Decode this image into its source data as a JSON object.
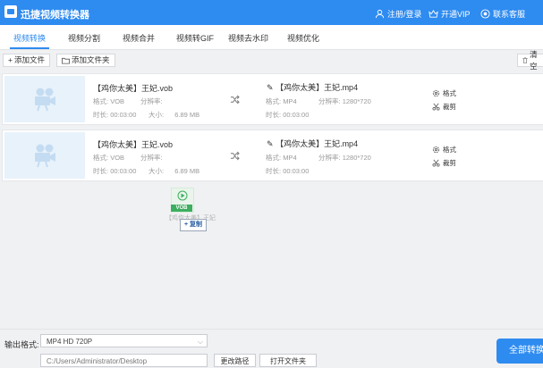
{
  "app": {
    "title": "迅捷视频转换器"
  },
  "titlebar": {
    "login": "注册/登录",
    "vip": "开通VIP",
    "service": "联系客服"
  },
  "tabs": [
    "视频转换",
    "视频分割",
    "视频合并",
    "视频转GIF",
    "视频去水印",
    "视频优化"
  ],
  "toolbar": {
    "add_file": "添加文件",
    "add_folder": "添加文件夹",
    "clear": "清空"
  },
  "files": [
    {
      "source_name": "【鸡你太美】王妃.vob",
      "format_label": "格式:",
      "format": "VOB",
      "resolution_label": "分辨率:",
      "resolution": "",
      "duration_label": "时长:",
      "duration": "00:03:00",
      "size_label": "大小:",
      "size": "6.89 MB",
      "output_name": "【鸡你太美】王妃.mp4",
      "out_format_label": "格式:",
      "out_format": "MP4",
      "out_resolution_label": "分辨率:",
      "out_resolution": "1280*720",
      "out_duration_label": "时长:",
      "out_duration": "00:03:00",
      "format_action": "格式",
      "cut_action": "裁剪"
    },
    {
      "source_name": "【鸡你太美】王妃.vob",
      "format_label": "格式:",
      "format": "VOB",
      "resolution_label": "分辨率:",
      "resolution": "",
      "duration_label": "时长:",
      "duration": "00:03:00",
      "size_label": "大小:",
      "size": "6.89 MB",
      "output_name": "【鸡你太美】王妃.mp4",
      "out_format_label": "格式:",
      "out_format": "MP4",
      "out_resolution_label": "分辨率:",
      "out_resolution": "1280*720",
      "out_duration_label": "时长:",
      "out_duration": "00:03:00",
      "format_action": "格式",
      "cut_action": "裁剪"
    }
  ],
  "drag": {
    "tag": "VOB",
    "text": "【鸡你太美】王妃",
    "copy_label": "+ 复制"
  },
  "bottom": {
    "output_format_label": "输出格式:",
    "output_format_value": "MP4  HD 720P",
    "output_dir_value": "C:/Users/Administrator/Desktop",
    "change_dir": "更改路径",
    "open_folder": "打开文件夹",
    "convert_all": "全部转换"
  },
  "colors": {
    "accent": "#2e8bf0",
    "vob_tag": "#3dae5f"
  }
}
